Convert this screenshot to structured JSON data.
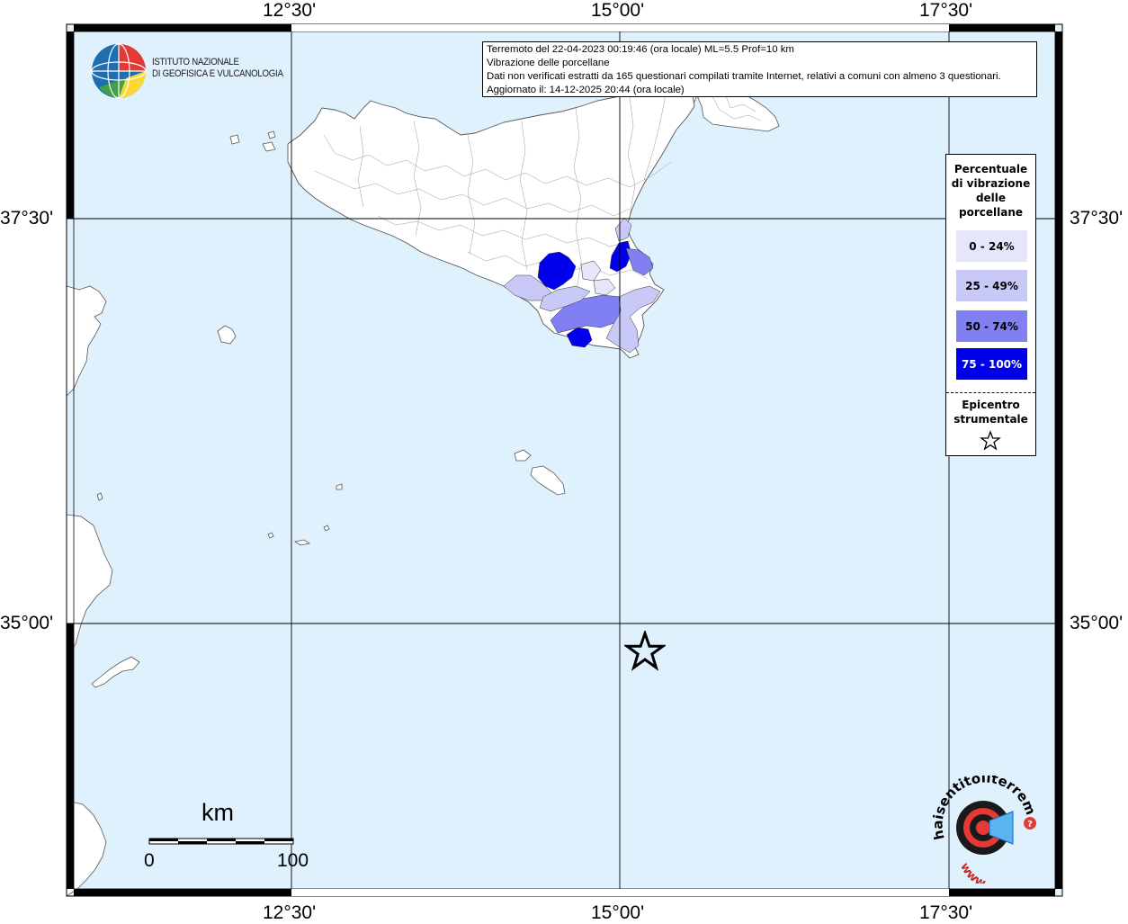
{
  "map": {
    "grid_labels": {
      "top": [
        "12°30'",
        "15°00'",
        "17°30'"
      ],
      "bottom": [
        "12°30'",
        "15°00'",
        "17°30'"
      ],
      "left": [
        "37°30'",
        "35°00'"
      ],
      "right": [
        "37°30'",
        "35°00'"
      ]
    },
    "colors": {
      "sea": "#e0f1fe",
      "land": "#ffffff",
      "c0": "#e6e6fb",
      "c1": "#c9c9f7",
      "c2": "#8080f2",
      "c3": "#0000ea"
    }
  },
  "institute": {
    "line1": "ISTITUTO NAZIONALE",
    "line2": "DI GEOFISICA E VULCANOLOGIA"
  },
  "info": {
    "line1": "Terremoto del 22-04-2023 00:19:46 (ora locale) ML=5.5 Prof=10 km",
    "line2": "Vibrazione delle porcellane",
    "line3": "Dati non verificati estratti da 165 questionari compilati tramite Internet, relativi a comuni con almeno 3 questionari.",
    "line4": "Aggiornato il: 14-12-2025 20:44 (ora locale)"
  },
  "legend": {
    "title_lines": [
      "Percentuale",
      "di vibrazione",
      "delle",
      "porcellane"
    ],
    "items": [
      {
        "label": "0 - 24%",
        "color": "#e6e6fb",
        "text_color": "#000000"
      },
      {
        "label": "25 - 49%",
        "color": "#c9c9f7",
        "text_color": "#000000"
      },
      {
        "label": "50 - 74%",
        "color": "#8080f2",
        "text_color": "#000000"
      },
      {
        "label": "75 - 100%",
        "color": "#0000ea",
        "text_color": "#ffffff"
      }
    ],
    "epicenter_lines": [
      "Epicentro",
      "strumentale"
    ],
    "epicenter_icon": "star-outline-icon"
  },
  "scale": {
    "unit": "km",
    "min_label": "0",
    "max_label": "100"
  },
  "brand": {
    "text": "haisentitoilterremoto.it",
    "www": "www.",
    "icon": "speaker-target-icon"
  }
}
